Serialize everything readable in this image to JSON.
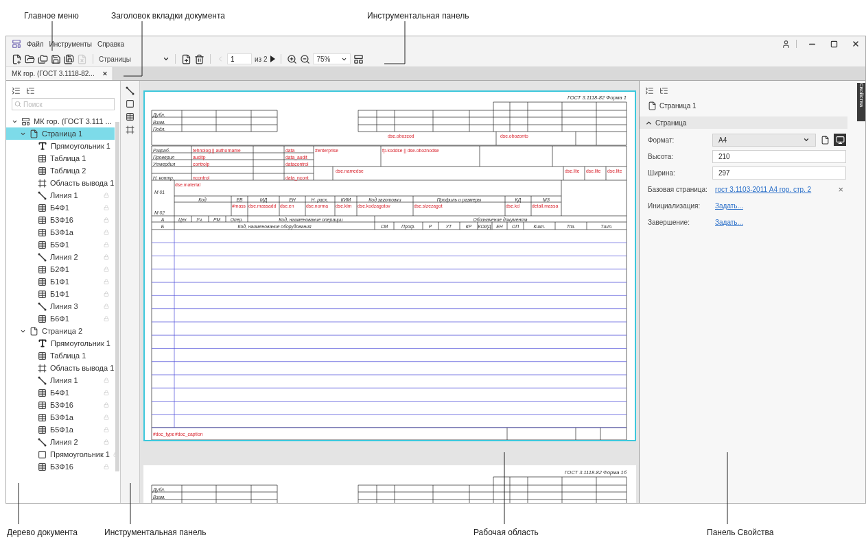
{
  "annotations": {
    "top": [
      "Главное меню",
      "Заголовок вкладки документа",
      "Инструментальная панель"
    ],
    "bottom": [
      "Дерево документа",
      "Инструментальная панель",
      "Рабочая область",
      "Панель Свойства"
    ]
  },
  "menu": [
    "Файл",
    "Инструменты",
    "Справка"
  ],
  "toolbar": {
    "pages_label": "Страницы",
    "page_input": "1",
    "page_total": "из 2",
    "zoom": "75%"
  },
  "tabs": [
    {
      "label": "МК гор. (ГОСТ 3.1118-82...",
      "close": "×",
      "selected": true
    }
  ],
  "tree": {
    "search_placeholder": "Поиск",
    "items": [
      {
        "label": "МК гор. (ГОСТ 3.111 ...",
        "kind": "doc",
        "expanded": true,
        "selected": false,
        "children": [
          {
            "label": "Страница 1",
            "kind": "page",
            "expanded": true,
            "selected": true,
            "children": [
              {
                "label": "Прямоугольник 1",
                "kind": "text",
                "selected": false,
                "locked": false
              },
              {
                "label": "Таблица 1",
                "kind": "table",
                "selected": false,
                "locked": false
              },
              {
                "label": "Таблица 2",
                "kind": "table",
                "selected": false,
                "locked": false
              },
              {
                "label": "Область вывода 1",
                "kind": "area",
                "selected": false,
                "locked": false
              },
              {
                "label": "Линия 1",
                "kind": "line",
                "selected": false,
                "locked": true
              },
              {
                "label": "Б4Ф1",
                "kind": "table",
                "selected": false,
                "locked": true
              },
              {
                "label": "Б3Ф16",
                "kind": "table",
                "selected": false,
                "locked": true
              },
              {
                "label": "Б3Ф1а",
                "kind": "table",
                "selected": false,
                "locked": true
              },
              {
                "label": "Б5Ф1",
                "kind": "table",
                "selected": false,
                "locked": true
              },
              {
                "label": "Линия 2",
                "kind": "line",
                "selected": false,
                "locked": true
              },
              {
                "label": "Б2Ф1",
                "kind": "table",
                "selected": false,
                "locked": true
              },
              {
                "label": "Б1Ф1",
                "kind": "table",
                "selected": false,
                "locked": true
              },
              {
                "label": "Б1Ф1",
                "kind": "table",
                "selected": false,
                "locked": true
              },
              {
                "label": "Линия 3",
                "kind": "line",
                "selected": false,
                "locked": true
              },
              {
                "label": "Б6Ф1",
                "kind": "table",
                "selected": false,
                "locked": true
              }
            ]
          },
          {
            "label": "Страница 2",
            "kind": "page",
            "expanded": true,
            "selected": false,
            "children": [
              {
                "label": "Прямоугольник 1",
                "kind": "text",
                "selected": false,
                "locked": false
              },
              {
                "label": "Таблица 1",
                "kind": "table",
                "selected": false,
                "locked": false
              },
              {
                "label": "Область вывода 1",
                "kind": "area",
                "selected": false,
                "locked": false
              },
              {
                "label": "Линия 1",
                "kind": "line",
                "selected": false,
                "locked": true
              },
              {
                "label": "Б4Ф1",
                "kind": "table",
                "selected": false,
                "locked": true
              },
              {
                "label": "Б3Ф16",
                "kind": "table",
                "selected": false,
                "locked": true
              },
              {
                "label": "Б3Ф1а",
                "kind": "table",
                "selected": false,
                "locked": true
              },
              {
                "label": "Б5Ф1а",
                "kind": "table",
                "selected": false,
                "locked": true
              },
              {
                "label": "Линия 2",
                "kind": "line",
                "selected": false,
                "locked": true
              },
              {
                "label": "Прямоугольник 1",
                "kind": "rect",
                "selected": false,
                "locked": true
              },
              {
                "label": "Б3Ф16",
                "kind": "table",
                "selected": false,
                "locked": true
              }
            ]
          }
        ]
      }
    ]
  },
  "workspace": {
    "pages": [
      {
        "header": "ГОСТ 3.1118-82 Форма 1",
        "selected": true,
        "labels": [
          {
            "text": "Дубл.",
            "kind": "caption"
          },
          {
            "text": "Взам.",
            "kind": "caption"
          },
          {
            "text": "Подл.",
            "kind": "caption"
          },
          {
            "text": "Разраб.",
            "kind": "caption"
          },
          {
            "text": "Проверил",
            "kind": "caption"
          },
          {
            "text": "Утвердил",
            "kind": "caption"
          },
          {
            "text": "Н. контр.",
            "kind": "caption"
          },
          {
            "text": "М 01",
            "kind": "caption"
          },
          {
            "text": "М 02",
            "kind": "caption"
          },
          {
            "text": "Код",
            "kind": "caption"
          },
          {
            "text": "ЕВ",
            "kind": "caption"
          },
          {
            "text": "МД",
            "kind": "caption"
          },
          {
            "text": "ЕН",
            "kind": "caption"
          },
          {
            "text": "Н. расх.",
            "kind": "caption"
          },
          {
            "text": "КИМ",
            "kind": "caption"
          },
          {
            "text": "Код заготовки",
            "kind": "caption"
          },
          {
            "text": "Профиль и размеры",
            "kind": "caption"
          },
          {
            "text": "КД",
            "kind": "caption"
          },
          {
            "text": "МЗ",
            "kind": "caption"
          },
          {
            "text": "А",
            "kind": "caption"
          },
          {
            "text": "Б",
            "kind": "caption"
          },
          {
            "text": "Цех",
            "kind": "caption"
          },
          {
            "text": "Уч.",
            "kind": "caption"
          },
          {
            "text": "РМ",
            "kind": "caption"
          },
          {
            "text": "Опер.",
            "kind": "caption"
          },
          {
            "text": "Код, наименование операции",
            "kind": "caption"
          },
          {
            "text": "Обозначение документа",
            "kind": "caption"
          },
          {
            "text": "Код, наименование оборудования",
            "kind": "caption"
          },
          {
            "text": "СМ",
            "kind": "caption"
          },
          {
            "text": "Проф.",
            "kind": "caption"
          },
          {
            "text": "Р",
            "kind": "caption"
          },
          {
            "text": "УТ",
            "kind": "caption"
          },
          {
            "text": "КР",
            "kind": "caption"
          },
          {
            "text": "КОИД",
            "kind": "caption"
          },
          {
            "text": "ЕН",
            "kind": "caption"
          },
          {
            "text": "ОП",
            "kind": "caption"
          },
          {
            "text": "Кшт.",
            "kind": "caption"
          },
          {
            "text": "Тпз.",
            "kind": "caption"
          },
          {
            "text": "Тшт.",
            "kind": "caption"
          },
          {
            "text": "dse.obozcod",
            "kind": "field"
          },
          {
            "text": "dse.obozonto",
            "kind": "field"
          },
          {
            "text": "tehnolog || authorname",
            "kind": "field"
          },
          {
            "text": "auditp",
            "kind": "field"
          },
          {
            "text": "controlp",
            "kind": "field"
          },
          {
            "text": "ncontrol",
            "kind": "field"
          },
          {
            "text": "data",
            "kind": "field"
          },
          {
            "text": "data_audit",
            "kind": "field"
          },
          {
            "text": "datacontrol",
            "kind": "field"
          },
          {
            "text": "data_ncont",
            "kind": "field"
          },
          {
            "text": "#enterprise",
            "kind": "field"
          },
          {
            "text": "fp.koddse || dse.oboznodse",
            "kind": "field"
          },
          {
            "text": "dse.namedse",
            "kind": "field"
          },
          {
            "text": "dse.lite",
            "kind": "field"
          },
          {
            "text": "dse.lite",
            "kind": "field"
          },
          {
            "text": "dse.lite",
            "kind": "field"
          },
          {
            "text": "dse.material",
            "kind": "field"
          },
          {
            "text": "#mass",
            "kind": "field"
          },
          {
            "text": "dse.massadd",
            "kind": "field"
          },
          {
            "text": "dse.en",
            "kind": "field"
          },
          {
            "text": "dse.norma",
            "kind": "field"
          },
          {
            "text": "dse.kim",
            "kind": "field"
          },
          {
            "text": "dse.kodzagotov",
            "kind": "field"
          },
          {
            "text": "dse.sizezagot",
            "kind": "field"
          },
          {
            "text": "dse.kd",
            "kind": "field"
          },
          {
            "text": "detail.massa",
            "kind": "field"
          },
          {
            "text": "#doc_type",
            "kind": "field"
          },
          {
            "text": "#doc_caption",
            "kind": "field"
          }
        ]
      },
      {
        "header": "ГОСТ 3.1118-82 Форма 1б",
        "selected": false,
        "labels": [
          {
            "text": "Дубл.",
            "kind": "caption"
          },
          {
            "text": "Взам.",
            "kind": "caption"
          }
        ]
      }
    ]
  },
  "properties": {
    "object": "Страница 1",
    "section": {
      "title": "Страница",
      "expanded": true
    },
    "fields": [
      {
        "label": "Формат:",
        "kind": "select",
        "value": "A4"
      },
      {
        "label": "Высота:",
        "kind": "input",
        "value": "210"
      },
      {
        "label": "Ширина:",
        "kind": "input",
        "value": "297"
      },
      {
        "label": "Базовая страница:",
        "kind": "link",
        "value": "гост 3.1103-2011 А4 гор. стр. 2",
        "clear": "×"
      },
      {
        "label": "Инициализация:",
        "kind": "link",
        "value": "Задать..."
      },
      {
        "label": "Завершение:",
        "kind": "link",
        "value": "Задать..."
      }
    ],
    "orientations": [
      {
        "kind": "portrait",
        "selected": false
      },
      {
        "kind": "landscape",
        "selected": true
      }
    ]
  },
  "side_tab": "Свойства"
}
